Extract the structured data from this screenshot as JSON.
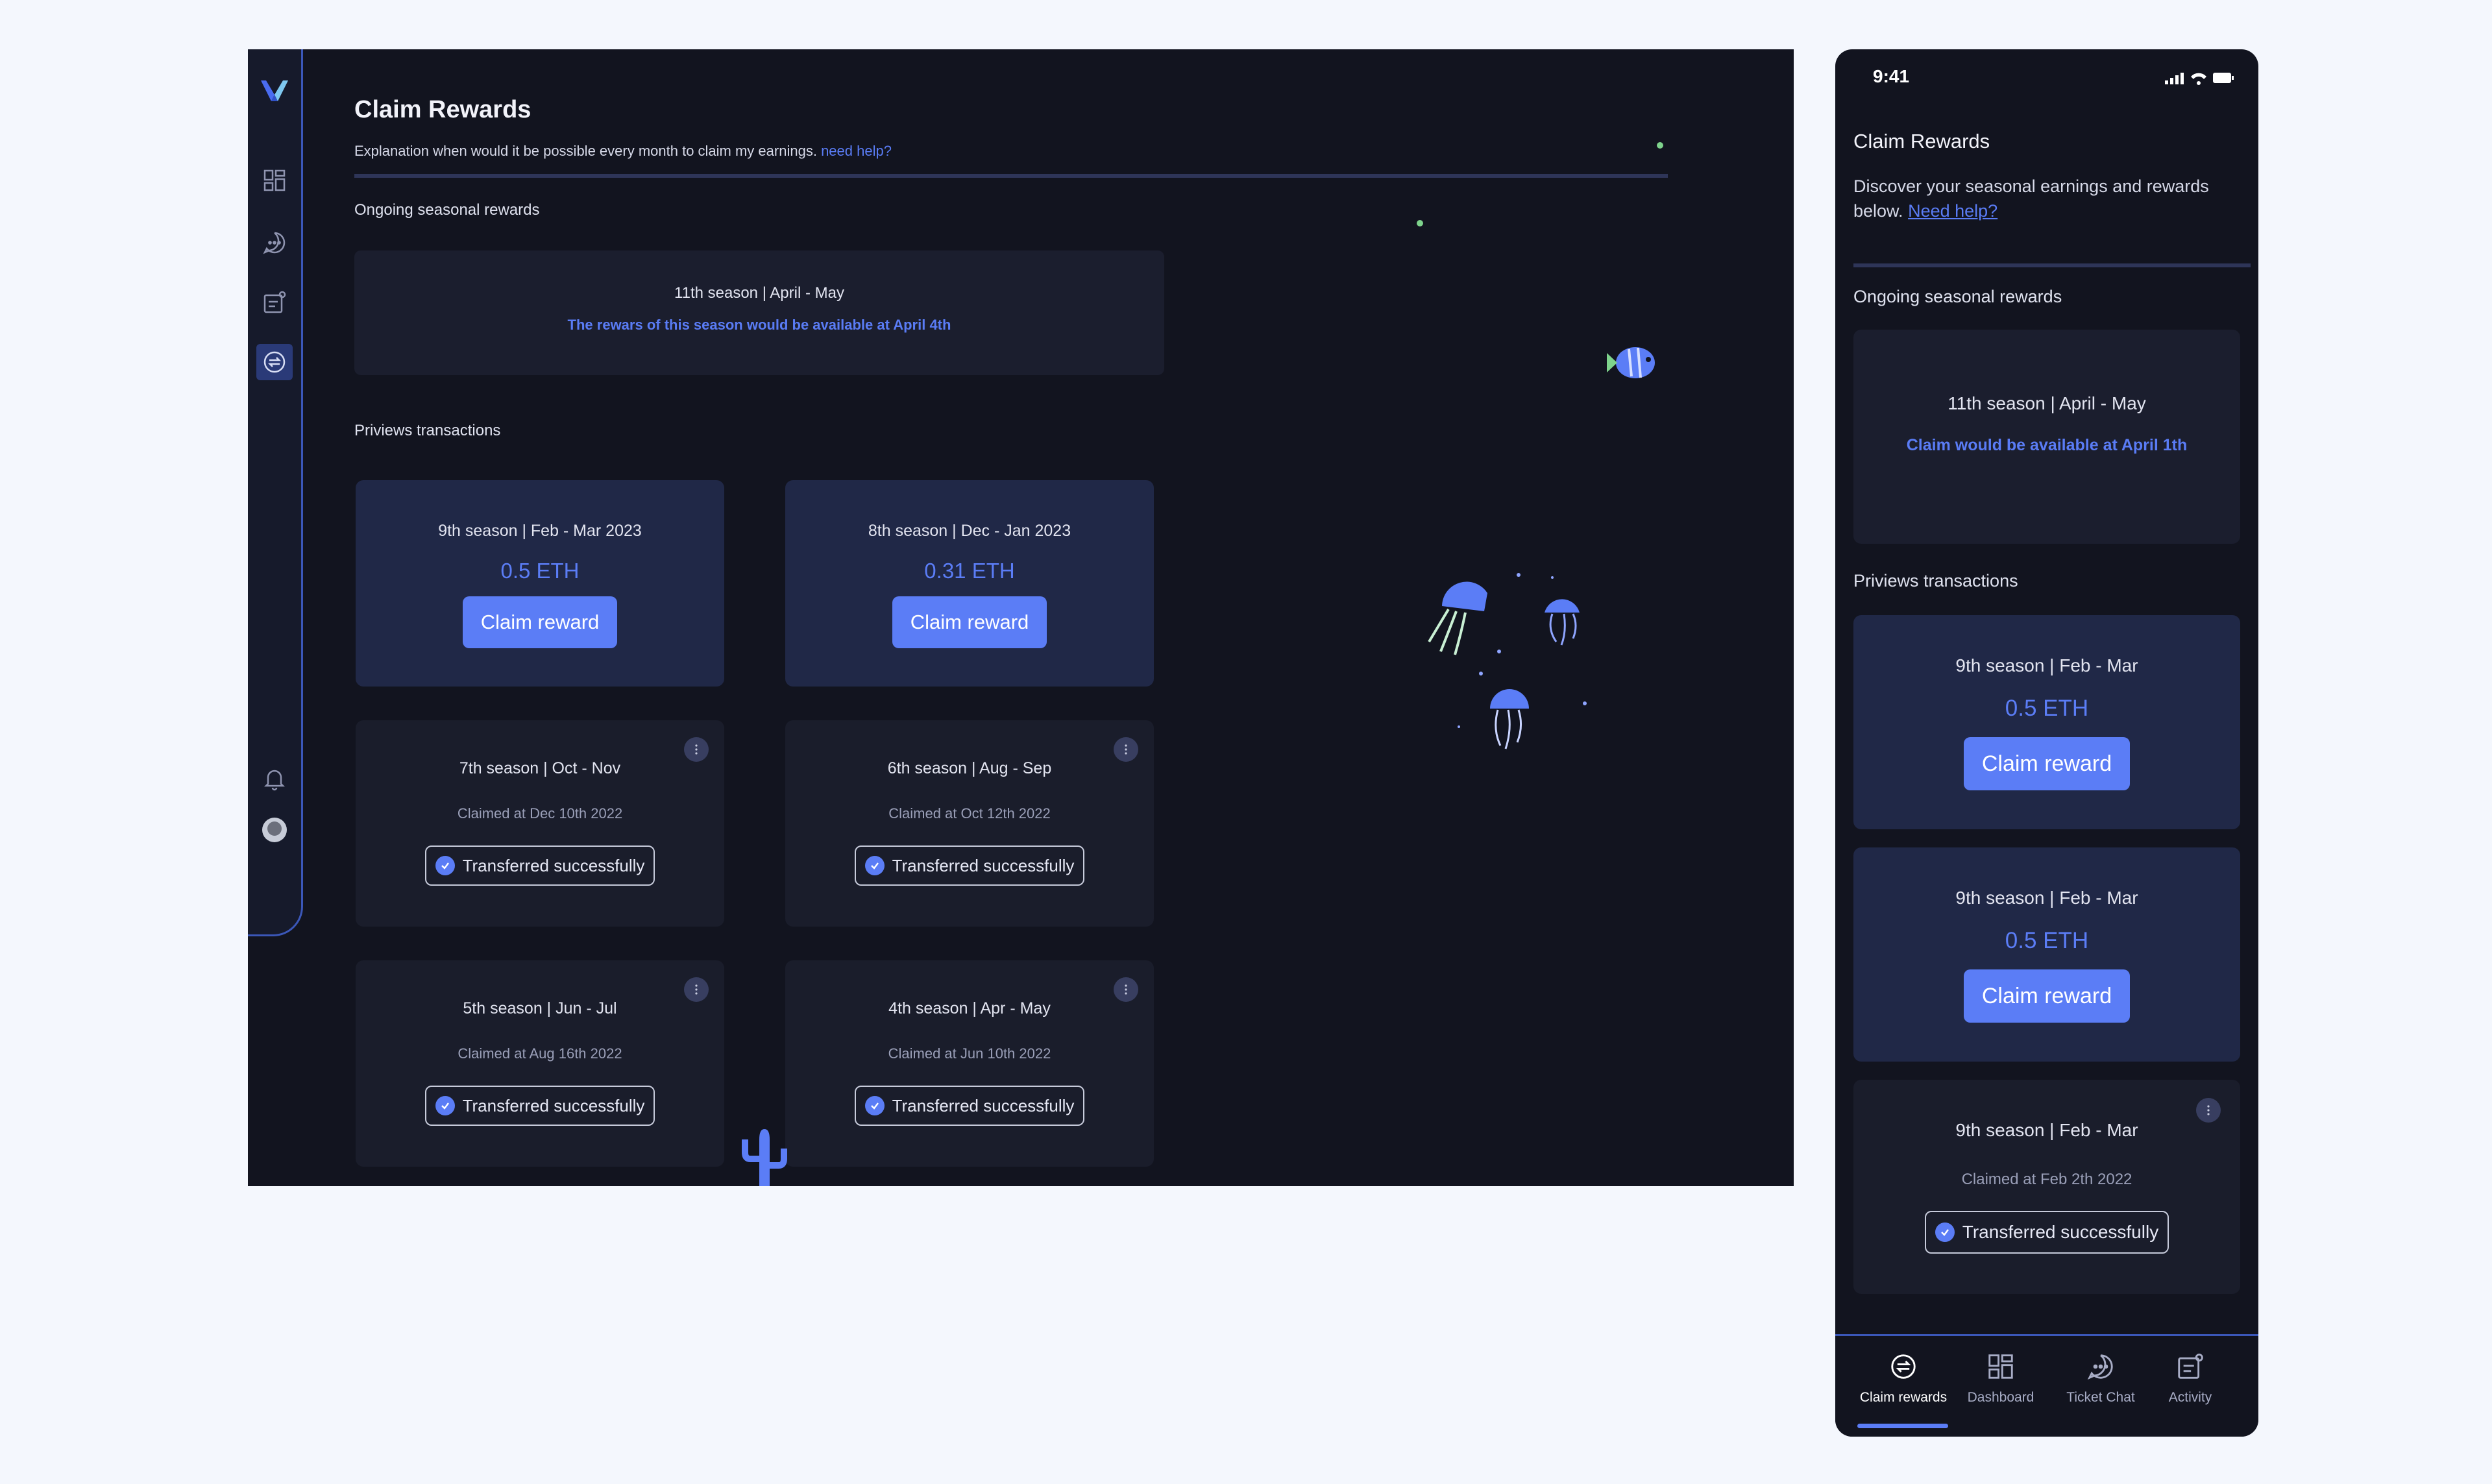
{
  "desktop": {
    "title": "Claim Rewards",
    "description": "Explanation when would it be possible every month to claim my earnings.",
    "help_link": "need help?",
    "ongoing_label": "Ongoing seasonal rewards",
    "current_season": {
      "title": "11th season | April - May",
      "note": "The rewars of this season would be available at April 4th"
    },
    "previous_label": "Priviews transactions",
    "claim_cards": [
      {
        "title": "9th season | Feb - Mar 2023",
        "amount": "0.5 ETH",
        "button": "Claim reward"
      },
      {
        "title": "8th season | Dec - Jan 2023",
        "amount": "0.31 ETH",
        "button": "Claim reward"
      }
    ],
    "done_cards": [
      {
        "title": "7th season | Oct - Nov",
        "claimed": "Claimed at Dec 10th 2022",
        "status": "Transferred successfully"
      },
      {
        "title": "6th season | Aug - Sep",
        "claimed": "Claimed at Oct 12th 2022",
        "status": "Transferred successfully"
      },
      {
        "title": "5th season | Jun - Jul",
        "claimed": "Claimed at Aug 16th  2022",
        "status": "Transferred successfully"
      },
      {
        "title": "4th season | Apr - May",
        "claimed": "Claimed at Jun 10th  2022",
        "status": "Transferred successfully"
      }
    ],
    "sidebar_icons": [
      "dashboard-icon",
      "chat-icon",
      "activity-icon",
      "claim-rewards-icon",
      "bell-icon",
      "avatar"
    ]
  },
  "mobile": {
    "time": "9:41",
    "title": "Claim Rewards",
    "description": "Discover your seasonal earnings and rewards below.",
    "help_link": "Need help?",
    "ongoing_label": "Ongoing seasonal rewards",
    "current_season": {
      "title": "11th season | April - May",
      "note": "Claim would be available at April 1th"
    },
    "previous_label": "Priviews transactions",
    "claim_cards": [
      {
        "title": "9th season | Feb - Mar",
        "amount": "0.5 ETH",
        "button": "Claim reward"
      },
      {
        "title": "9th season | Feb - Mar",
        "amount": "0.5 ETH",
        "button": "Claim reward"
      }
    ],
    "done_card": {
      "title": "9th season | Feb - Mar",
      "claimed": "Claimed at Feb 2th  2022",
      "status": "Transferred successfully"
    },
    "tabs": [
      {
        "label": "Claim rewards",
        "icon": "claim-rewards-icon",
        "active": true
      },
      {
        "label": "Dashboard",
        "icon": "dashboard-icon",
        "active": false
      },
      {
        "label": "Ticket Chat",
        "icon": "chat-icon",
        "active": false
      },
      {
        "label": "Activity",
        "icon": "activity-icon",
        "active": false
      }
    ]
  },
  "colors": {
    "background": "#f4f7fd",
    "panel": "#12141f",
    "card": "#1a1d2b",
    "claim_card": "#202847",
    "accent": "#5b7df6"
  }
}
